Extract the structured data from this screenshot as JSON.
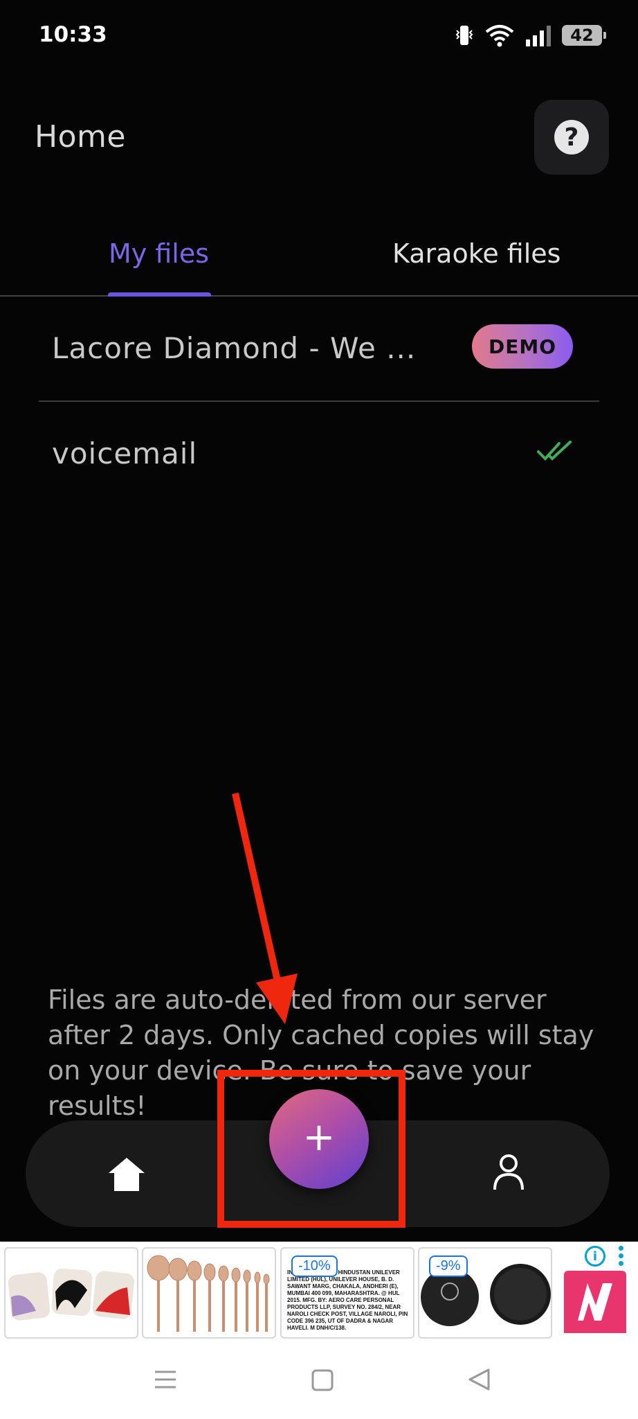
{
  "status_bar": {
    "time": "10:33",
    "battery": "42"
  },
  "header": {
    "title": "Home",
    "help_icon": "?"
  },
  "tabs": [
    {
      "label": "My files",
      "active": true
    },
    {
      "label": "Karaoke files",
      "active": false
    }
  ],
  "files": [
    {
      "name": "Lacore Diamond - We ...",
      "badge": "DEMO"
    },
    {
      "name": "voicemail",
      "status_icon": "double-check-icon"
    }
  ],
  "info_text": "Files are auto-deleted from our server after 2 days. Only cached copies will stay on your device. Be sure to save your results!",
  "bottom_nav": {
    "items": [
      "home-icon",
      "add-icon",
      "profile-icon"
    ],
    "fab_label": "+"
  },
  "ad_banner": {
    "items": [
      {
        "name": "sponges"
      },
      {
        "name": "brush-set"
      },
      {
        "name": "label",
        "discount": "-10%",
        "text": "IN INDIA. MFD. BY: HINDUSTAN UNILEVER LIMITED (HUL), UNILEVER HOUSE, B. D. SAWANT MARG, CHAKALA, ANDHERI (E), MUMBAI 400 099, MAHARASHTRA. @ HUL 2015. MFG. BY: AERO CARE PERSONAL PRODUCTS LLP, SURVEY NO. 284/2, NEAR NAROLI CHECK POST, VILLAGE NAROLI, PIN CODE 396 235, UT OF DADRA & NAGAR HAVELI. M DNH/C/138."
      },
      {
        "name": "compact",
        "discount": "-9%"
      },
      {
        "name": "brand-logo"
      }
    ],
    "info_icon": "i"
  },
  "colors": {
    "accent": "#6a55e0",
    "background": "#050505",
    "annotation": "#f0270f",
    "check": "#3fae5a"
  }
}
